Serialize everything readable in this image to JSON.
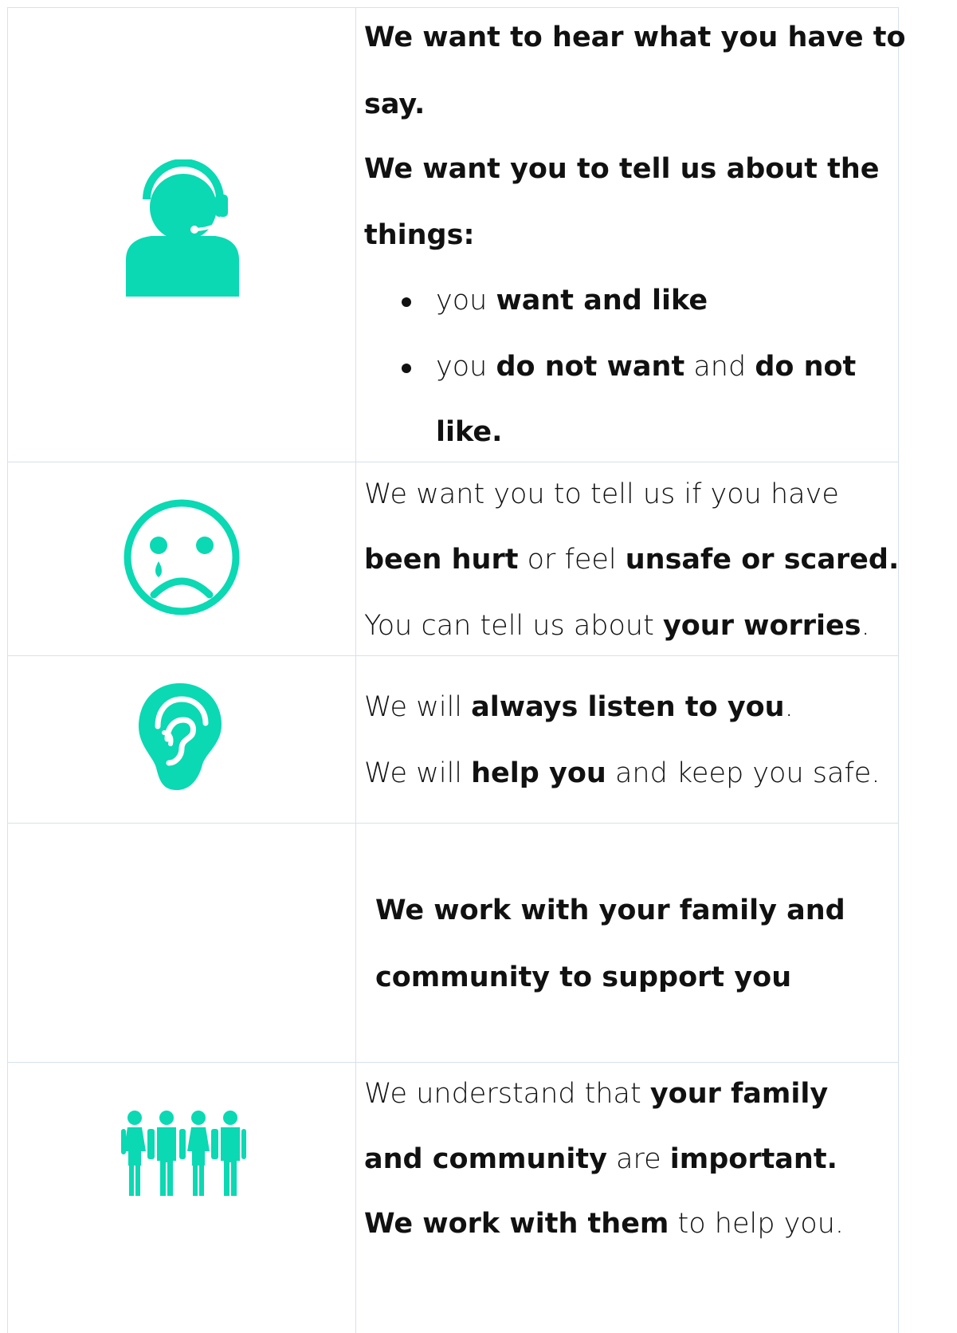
{
  "accent_color": "#0ad9b3",
  "rows": [
    {
      "icon": "headset-person-icon",
      "lines": [
        [
          "We want to hear what you have to"
        ],
        [
          "say."
        ],
        [
          "We want you to tell us about the"
        ],
        [
          "things:"
        ]
      ],
      "bullets": [
        {
          "a": "you ",
          "b": "want and like"
        },
        {
          "a": "you ",
          "b": "do not want",
          "c": " and ",
          "d": "do not"
        }
      ],
      "bullet_cont": "like."
    },
    {
      "icon": "sad-face-icon",
      "line1": "We want you to tell us if you have",
      "line2_b1": "been hurt",
      "line2_a": " or feel ",
      "line2_b2": "unsafe or scared.",
      "line3_a": "You can tell us about ",
      "line3_b": "your worries",
      "line3_c": "."
    },
    {
      "icon": "ear-icon",
      "line1_a": "We will ",
      "line1_b": "always listen to you",
      "line1_c": ".",
      "line2_a": "We will ",
      "line2_b": "help you",
      "line2_c": " and keep you safe."
    },
    {
      "heading_1": "We work with your family and",
      "heading_2": "community to support you"
    },
    {
      "icon": "family-group-icon",
      "line1_a": "We understand that ",
      "line1_b": "your family",
      "line2_b1": "and community",
      "line2_a": " are ",
      "line2_b2": "important.",
      "line3_b": "We work with them",
      "line3_a": " to help you."
    }
  ]
}
